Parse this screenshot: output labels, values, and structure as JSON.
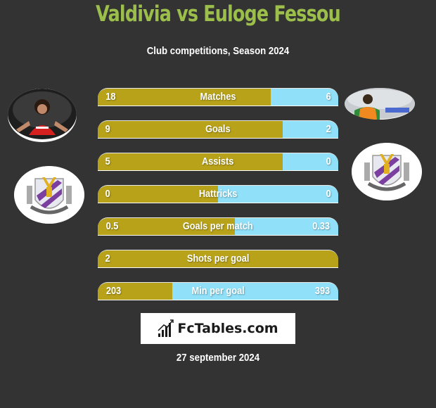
{
  "header": {
    "title": "Valdivia vs Euloge Fessou",
    "subtitle": "Club competitions, Season 2024"
  },
  "players": {
    "left": {
      "name": "Valdivia",
      "photo": "player-photo-red-jersey"
    },
    "right": {
      "name": "Euloge Fessou",
      "photo": "player-photo-orange-bib"
    }
  },
  "clubs": {
    "left": {
      "logo": "club-crest-purple-stripes"
    },
    "right": {
      "logo": "club-crest-purple-stripes"
    }
  },
  "colors": {
    "background": "#333333",
    "title": "#9bbf4a",
    "left_bar": "#b8a219",
    "right_bar": "#8fe0f8"
  },
  "stats": [
    {
      "label": "Matches",
      "left": "18",
      "right": "6",
      "left_share": 0.72
    },
    {
      "label": "Goals",
      "left": "9",
      "right": "2",
      "left_share": 0.77
    },
    {
      "label": "Assists",
      "left": "5",
      "right": "0",
      "left_share": 0.77
    },
    {
      "label": "Hattricks",
      "left": "0",
      "right": "0",
      "left_share": 0.5
    },
    {
      "label": "Goals per match",
      "left": "0.5",
      "right": "0.33",
      "left_share": 0.57
    },
    {
      "label": "Shots per goal",
      "left": "2",
      "right": "",
      "left_share": 1.0
    },
    {
      "label": "Min per goal",
      "left": "203",
      "right": "393",
      "left_share": 0.31
    }
  ],
  "brand": {
    "name": "FcTables.com",
    "icon": "bar-chart-icon"
  },
  "footer": {
    "date": "27 september 2024"
  }
}
